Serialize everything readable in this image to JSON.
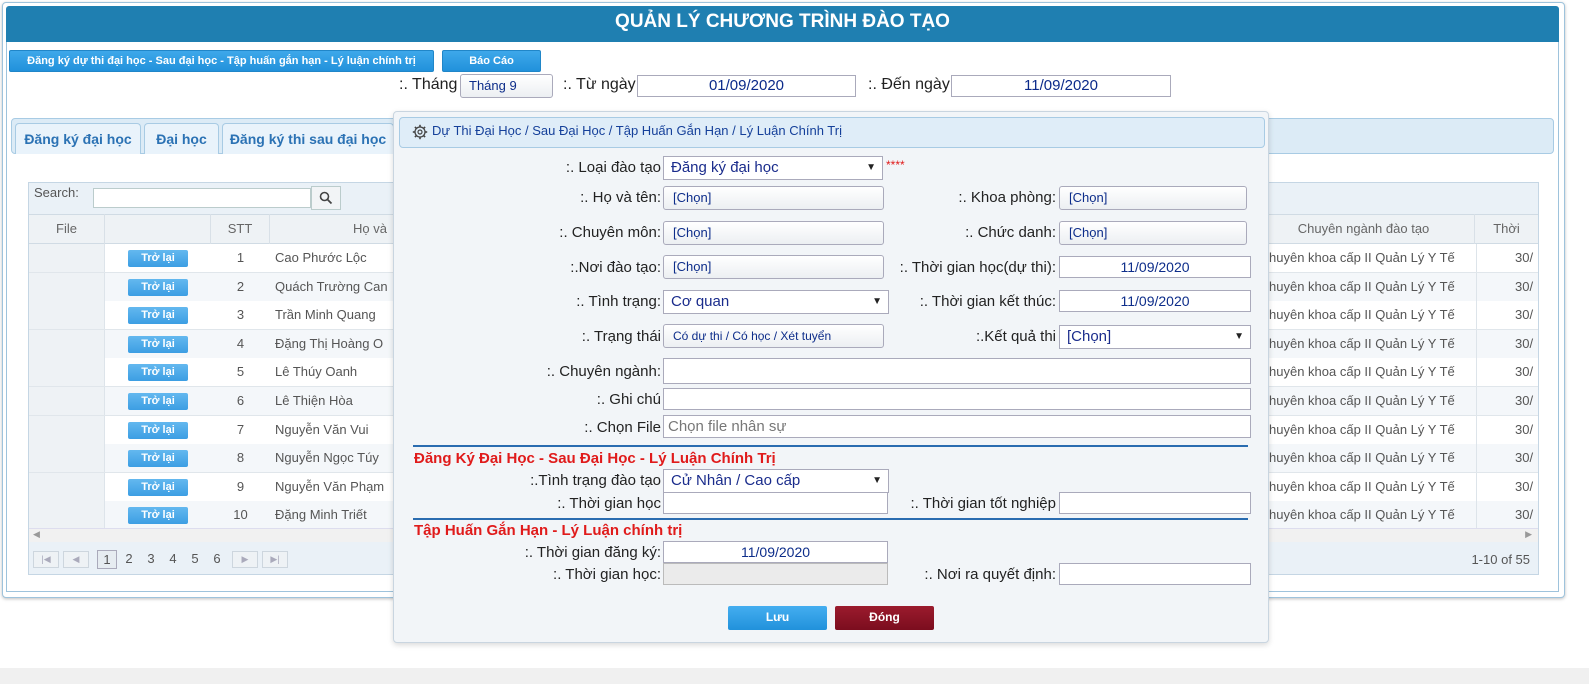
{
  "app": {
    "title": "QUẢN LÝ CHƯƠNG TRÌNH ĐÀO TẠO"
  },
  "toolbar": {
    "register_button": "Đăng ký dự thi đại học - Sau đại học - Tập huấn gắn hạn - Lý luận chính trị",
    "report_button": "Báo Cáo"
  },
  "filter": {
    "month_label": ":. Tháng",
    "month_value": "Tháng 9",
    "from_label": ":. Từ ngày",
    "from_value": "01/09/2020",
    "to_label": ":. Đến ngày",
    "to_value": "11/09/2020"
  },
  "tabs": [
    {
      "label": "Đăng ký đại học"
    },
    {
      "label": "Đại học"
    },
    {
      "label": "Đăng ký thi sau đại học"
    }
  ],
  "grid": {
    "search_label": "Search:",
    "columns": {
      "file": "File",
      "stt": "STT",
      "name": "Họ và",
      "major": "Chuyên ngành đào tạo",
      "time": "Thời"
    },
    "back_label": "Trở lại",
    "rows": [
      {
        "stt": "1",
        "name": "Cao Phước Lộc",
        "major": "huyên khoa cấp II Quản Lý Y Tế",
        "time": "30/"
      },
      {
        "stt": "2",
        "name": "Quách Trường Can",
        "major": "huyên khoa cấp II Quản Lý Y Tế",
        "time": "30/"
      },
      {
        "stt": "3",
        "name": "Trần Minh Quang",
        "major": "huyên khoa cấp II Quản Lý Y Tế",
        "time": "30/"
      },
      {
        "stt": "4",
        "name": "Đặng Thị Hoàng O",
        "major": "huyên khoa cấp II Quản Lý Y Tế",
        "time": "30/"
      },
      {
        "stt": "5",
        "name": "Lê Thúy Oanh",
        "major": "huyên khoa cấp II Quản Lý Y Tế",
        "time": "30/"
      },
      {
        "stt": "6",
        "name": "Lê Thiện Hòa",
        "major": "huyên khoa cấp II Quản Lý Y Tế",
        "time": "30/"
      },
      {
        "stt": "7",
        "name": "Nguyễn Văn Vui",
        "major": "huyên khoa cấp II Quản Lý Y Tế",
        "time": "30/"
      },
      {
        "stt": "8",
        "name": "Nguyễn Ngọc Túy",
        "major": "huyên khoa cấp II Quản Lý Y Tế",
        "time": "30/"
      },
      {
        "stt": "9",
        "name": "Nguyễn Văn Phạm",
        "major": "huyên khoa cấp II Quản Lý Y Tế",
        "time": "30/"
      },
      {
        "stt": "10",
        "name": "Đặng Minh Triết",
        "major": "huyên khoa cấp II Quản Lý Y Tế",
        "time": "30/"
      }
    ],
    "pages": [
      "1",
      "2",
      "3",
      "4",
      "5",
      "6"
    ],
    "current_page": "1",
    "record_info": "1-10 of 55"
  },
  "modal": {
    "title": "Dự Thi Đại Học / Sau Đại Học / Tập Huấn Gắn Hạn / Lý Luận Chính Trị",
    "training_type_label": ":. Loại đào tạo",
    "training_type_value": "Đăng ký đại học",
    "required_mark": "****",
    "fullname_label": ":. Họ và tên:",
    "fullname_value": "[Chọn]",
    "department_label": ":. Khoa phòng:",
    "department_value": "[Chọn]",
    "specialty_label": ":. Chuyên môn:",
    "specialty_value": "[Chọn]",
    "position_label": ":. Chức danh:",
    "position_value": "[Chọn]",
    "place_label": ":.Nơi đào tạo:",
    "place_value": "[Chọn]",
    "study_time_label": ":. Thời gian học(dự thi):",
    "study_time_value": "11/09/2020",
    "status_label": ":. Tình trạng:",
    "status_value": "Cơ quan",
    "end_time_label": ":. Thời gian kết thúc:",
    "end_time_value": "11/09/2020",
    "state_label": ":. Trạng thái",
    "state_value": "Có dự thi / Có học / Xét tuyển",
    "result_label": ":.Kết quả thi",
    "result_value": "[Chọn]",
    "major_label": ":. Chuyên ngành:",
    "note_label": ":. Ghi chú",
    "file_label": ":. Chọn File",
    "file_placeholder": "Chọn file nhân sự",
    "section1_title": "Đăng Ký Đại Học - Sau Đại Học - Lý Luận Chính Trị",
    "training_status_label": ":.Tình trạng đào tạo",
    "training_status_value": "Cử Nhân / Cao cấp",
    "study_period_label": ":. Thời gian học",
    "graduation_label": ":. Thời gian tốt nghiệp",
    "section2_title": "Tập Huấn Gắn Hạn - Lý Luận chính trị",
    "register_time_label": ":. Thời gian đăng ký:",
    "register_time_value": "11/09/2020",
    "study_time2_label": ":. Thời gian học:",
    "decision_place_label": ":. Nơi ra quyết định:",
    "save_button": "Lưu",
    "close_button": "Đóng"
  }
}
